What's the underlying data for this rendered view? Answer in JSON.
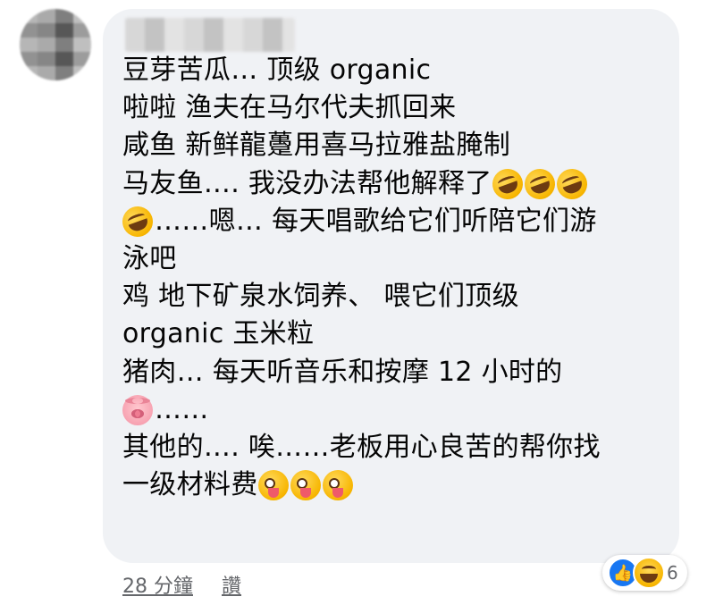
{
  "comment": {
    "lines": [
      "豆芽苦瓜… 顶级 organic",
      "啦啦 渔夫在马尔代夫抓回来",
      "咸鱼 新鲜龍躉用喜马拉雅盐腌制",
      "马友鱼…. 我没办法帮他解释了",
      "……嗯… 每天唱歌给它们听陪它们游",
      "泳吧",
      "鸡 地下矿泉水饲养、 喂它们顶级",
      "organic 玉米粒",
      "猪肉… 每天听音乐和按摩 12 小时的",
      "……",
      "其他的…. 唉……老板用心良苦的帮你找",
      "一级材料费"
    ],
    "emoji": {
      "rolling_on_floor_laughing": "rofl-emoji",
      "pig_face": "pig-emoji",
      "zany_face": "zany-emoji"
    }
  },
  "meta": {
    "time": "28 分鐘",
    "like_link": "讚"
  },
  "reactions": {
    "count": "6",
    "icons": [
      "like-icon",
      "haha-icon"
    ]
  },
  "colors": {
    "bubble": "#f0f2f5",
    "text": "#050505",
    "muted": "#65676b",
    "like_blue": "#1877f2"
  }
}
